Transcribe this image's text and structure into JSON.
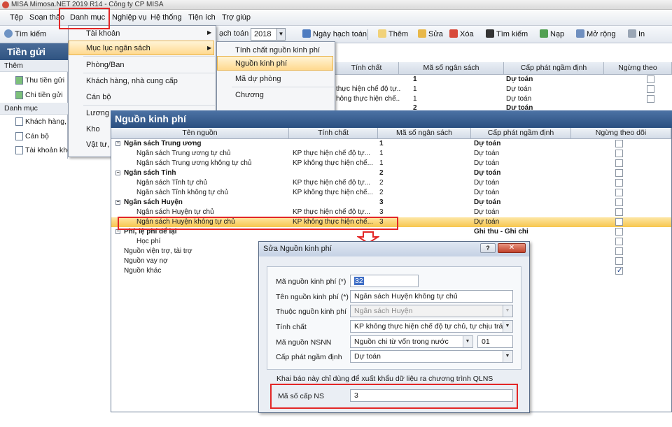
{
  "window": {
    "title": "MISA Mimosa.NET 2019 R14 - Công ty CP MISA"
  },
  "menubar": {
    "items": [
      "Tệp",
      "Soạn thảo",
      "Danh mục",
      "Nghiệp vụ",
      "Hệ thống",
      "Tiện ích",
      "Trợ giúp"
    ]
  },
  "toolbar": {
    "search": "Tìm kiếm",
    "posting_date_label": "ạch toán",
    "year": "2018",
    "posting_date_button": "Ngày hạch toán",
    "add": "Thêm",
    "edit": "Sửa",
    "delete": "Xóa",
    "find": "Tìm kiếm",
    "load": "Nạp",
    "expand": "Mở rộng",
    "print": "In"
  },
  "left_panel": {
    "title": "Tiền gửi",
    "section_add": "Thêm",
    "add_items": [
      "Thu tiền gửi",
      "Chi tiền gửi"
    ],
    "section_catalog": "Danh mục",
    "catalog_items": [
      "Khách hàng, n",
      "Cán bộ",
      "Tài khoản khc"
    ]
  },
  "danh_muc_menu": {
    "items": [
      "Tài khoản",
      "Mục lục ngân sách",
      "Phòng/Ban",
      "Khách hàng, nhà cung cấp",
      "Cán bộ",
      "Lương",
      "Kho",
      "Vật tư,"
    ]
  },
  "muc_luc_submenu": {
    "items": [
      "Tính chất nguồn kinh phí",
      "Nguồn kinh phí",
      "Mã dự phòng",
      "Chương"
    ]
  },
  "bg_grid": {
    "headers": [
      "Tính chất",
      "Mã số ngân sách",
      "Cấp phát ngầm định",
      "Ngừng theo"
    ],
    "rows": [
      {
        "tc": "",
        "ms": "1",
        "cp": "Dự toán"
      },
      {
        "tc": "thực hiện chế độ tự...",
        "ms": "1",
        "cp": "Dự toán"
      },
      {
        "tc": "hông thực hiện chế...",
        "ms": "1",
        "cp": "Dự toán"
      },
      {
        "tc": "",
        "ms": "2",
        "cp": "Dự toán"
      }
    ]
  },
  "nkp_window": {
    "title": "Nguồn kinh phí",
    "headers": [
      "Tên nguồn",
      "Tính chất",
      "Mã số ngân sách",
      "Cấp phát ngầm định",
      "Ngừng theo dõi"
    ],
    "rows": [
      {
        "name": "Ngân sách Trung ương",
        "tc": "",
        "ms": "1",
        "cp": "Dự toán",
        "group": true,
        "checked": false
      },
      {
        "name": "Ngân sách Trung ương tự chủ",
        "tc": "KP thực hiện chế độ tự...",
        "ms": "1",
        "cp": "Dự toán",
        "group": false,
        "checked": false
      },
      {
        "name": "Ngân sách Trung ương không tự chủ",
        "tc": "KP không thực hiện chế...",
        "ms": "1",
        "cp": "Dự toán",
        "group": false,
        "checked": false
      },
      {
        "name": "Ngân sách Tỉnh",
        "tc": "",
        "ms": "2",
        "cp": "Dự toán",
        "group": true,
        "checked": false
      },
      {
        "name": "Ngân sách Tỉnh tự chủ",
        "tc": "KP thực hiện chế độ tự...",
        "ms": "2",
        "cp": "Dự toán",
        "group": false,
        "checked": false
      },
      {
        "name": "Ngân sách Tỉnh không tự chủ",
        "tc": "KP không thực hiện chế...",
        "ms": "2",
        "cp": "Dự toán",
        "group": false,
        "checked": false
      },
      {
        "name": "Ngân sách Huyện",
        "tc": "",
        "ms": "3",
        "cp": "Dự toán",
        "group": true,
        "checked": false
      },
      {
        "name": "Ngân sách Huyện tự chủ",
        "tc": "KP thực hiện chế độ tự...",
        "ms": "3",
        "cp": "Dự toán",
        "group": false,
        "checked": false
      },
      {
        "name": "Ngân sách Huyện không tự chủ",
        "tc": "KP không thực hiện chế...",
        "ms": "3",
        "cp": "Dự toán",
        "group": false,
        "checked": false,
        "selected": true
      },
      {
        "name": "Phí, lệ phí để lại",
        "tc": "",
        "ms": "",
        "cp": "Ghi thu - Ghi chi",
        "group": true,
        "checked": false
      },
      {
        "name": "Học phí",
        "tc": "",
        "ms": "",
        "cp": "",
        "group": false,
        "checked": false
      },
      {
        "name": "Nguồn viện trợ, tài trợ",
        "tc": "",
        "ms": "",
        "cp": "",
        "group": false,
        "checked": false
      },
      {
        "name": "Nguồn vay nợ",
        "tc": "",
        "ms": "",
        "cp": "",
        "group": false,
        "checked": false
      },
      {
        "name": "Nguồn khác",
        "tc": "",
        "ms": "",
        "cp": "",
        "group": false,
        "checked": true
      }
    ]
  },
  "edit_dialog": {
    "title": "Sửa Nguồn kinh phí",
    "help_glyph": "?",
    "fields": {
      "code_label": "Mã nguồn kinh phí (*)",
      "code_value": "32",
      "name_label": "Tên nguồn kinh phí (*)",
      "name_value": "Ngân sách Huyện không tự chủ",
      "parent_label": "Thuộc nguồn kinh phí",
      "parent_value": "Ngân sách Huyện",
      "nature_label": "Tính chất",
      "nature_value": "KP không thực hiện chế độ tự chủ, tự chịu trách n",
      "nsnn_label": "Mã nguồn NSNN",
      "nsnn_value": "Nguồn chi từ vốn trong nước",
      "nsnn_code": "01",
      "alloc_label": "Cấp phát ngầm định",
      "alloc_value": "Dự toán"
    },
    "note": "Khai báo này chỉ dùng để xuất khẩu dữ liệu ra chương trình QLNS",
    "budget_code_label": "Mã số cấp NS",
    "budget_code_value": "3"
  },
  "colors": {
    "highlight_red": "#e32626",
    "selection_orange": "#f7c64d",
    "title_blue": "#2a4f80"
  }
}
